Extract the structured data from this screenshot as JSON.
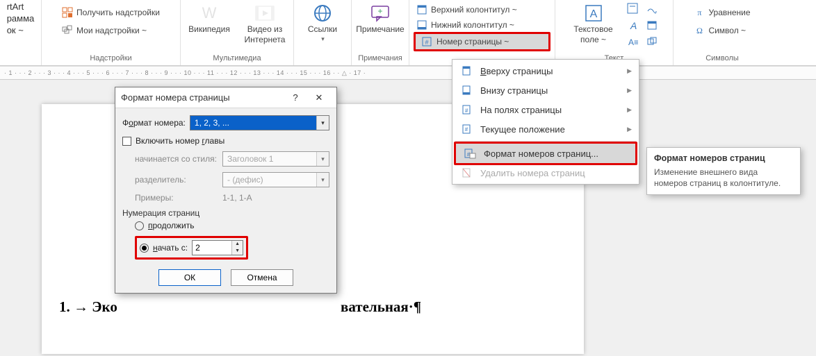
{
  "ribbon": {
    "left_partial": {
      "line1": "rtArt",
      "line2": "рамма",
      "line3": "ок ~"
    },
    "addins": {
      "get": "Получить надстройки",
      "my": "Мои надстройки ~",
      "group": "Надстройки"
    },
    "wiki": "Википедия",
    "video": {
      "line1": "Видео из",
      "line2": "Интернета",
      "group": "Мультимедиа"
    },
    "links": "Ссылки",
    "comment": {
      "btn": "Примечание",
      "group": "Примечания"
    },
    "headers": {
      "top": "Верхний колонтитул ~",
      "bottom": "Нижний колонтитул ~",
      "page_number": "Номер страницы ~"
    },
    "textbox": {
      "line1": "Текстовое",
      "line2": "поле ~",
      "group": "Текст"
    },
    "symbols": {
      "equation": "Уравнение",
      "symbol": "Символ ~",
      "group": "Символы"
    }
  },
  "ruler": "· 1 ·  ·  · 2 ·  ·  · 3 ·  ·  · 4 ·  ·  · 5 ·  ·  · 6 ·  ·  · 7 ·  ·  · 8 ·  ·  · 9 ·  ·  · 10 ·  ·  · 11 ·  ·  · 12 ·  ·  · 13 ·  ·  · 14 ·  ·  · 15 ·  ·  · 16 ·  · △ · 17 ·",
  "menu": {
    "top": "Вверху страницы",
    "bottom": "Внизу страницы",
    "margins": "На полях страницы",
    "current": "Текущее положение",
    "format": "Формат номеров страниц...",
    "remove": "Удалить номера страниц"
  },
  "dialog": {
    "title": "Формат номера страницы",
    "format_label_pre": "Ф",
    "format_label_key": "о",
    "format_label_post": "рмат номера:",
    "format_value": "1, 2, 3, ...",
    "include_pre": "Включить номер ",
    "include_key": "г",
    "include_post": "лавы",
    "starts_style": "начинается со стиля:",
    "starts_style_val": "Заголовок 1",
    "separator": "разделитель:",
    "separator_val": "-   (дефис)",
    "examples": "Примеры:",
    "examples_val": "1-1, 1-A",
    "numbering_title": "Нумерация страниц",
    "continue_pre": "",
    "continue_key": "п",
    "continue_post": "родолжить",
    "start_pre": "",
    "start_key": "н",
    "start_post": "ачать с:",
    "start_value": "2",
    "ok": "ОК",
    "cancel": "Отмена"
  },
  "tooltip": {
    "title": "Формат номеров страниц",
    "body": "Изменение внешнего вида номеров страниц в колонтитуле."
  },
  "document": {
    "left": "1.  →   Эко",
    "right": "вательная·¶"
  }
}
